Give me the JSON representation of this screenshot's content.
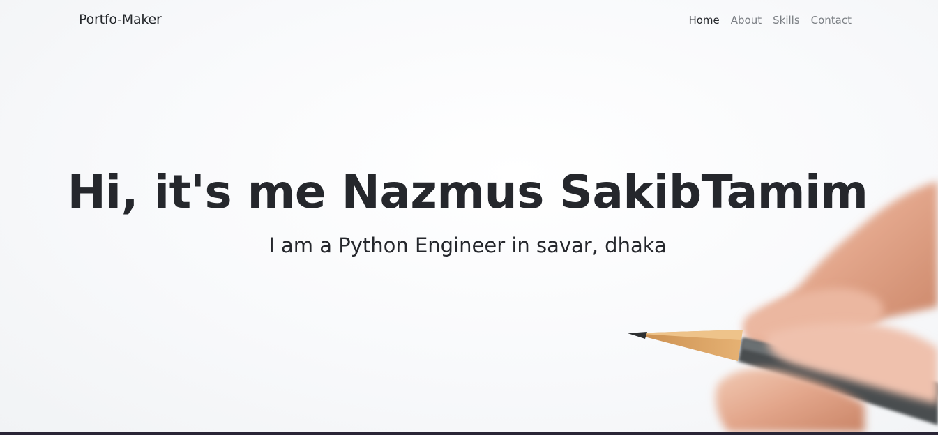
{
  "navbar": {
    "brand": "Portfo-Maker",
    "links": [
      {
        "label": "Home",
        "active": true
      },
      {
        "label": "About",
        "active": false
      },
      {
        "label": "Skills",
        "active": false
      },
      {
        "label": "Contact",
        "active": false
      }
    ]
  },
  "hero": {
    "title": "Hi, it's me Nazmus SakibTamim",
    "subtitle": "I am a Python Engineer in savar, dhaka",
    "background_image": "hand-holding-pencil-illustration"
  },
  "colors": {
    "background": "#f8f9fb",
    "text_dark": "#25272c",
    "nav_muted": "#7b7f84",
    "bottom_bar": "#2a2536"
  }
}
